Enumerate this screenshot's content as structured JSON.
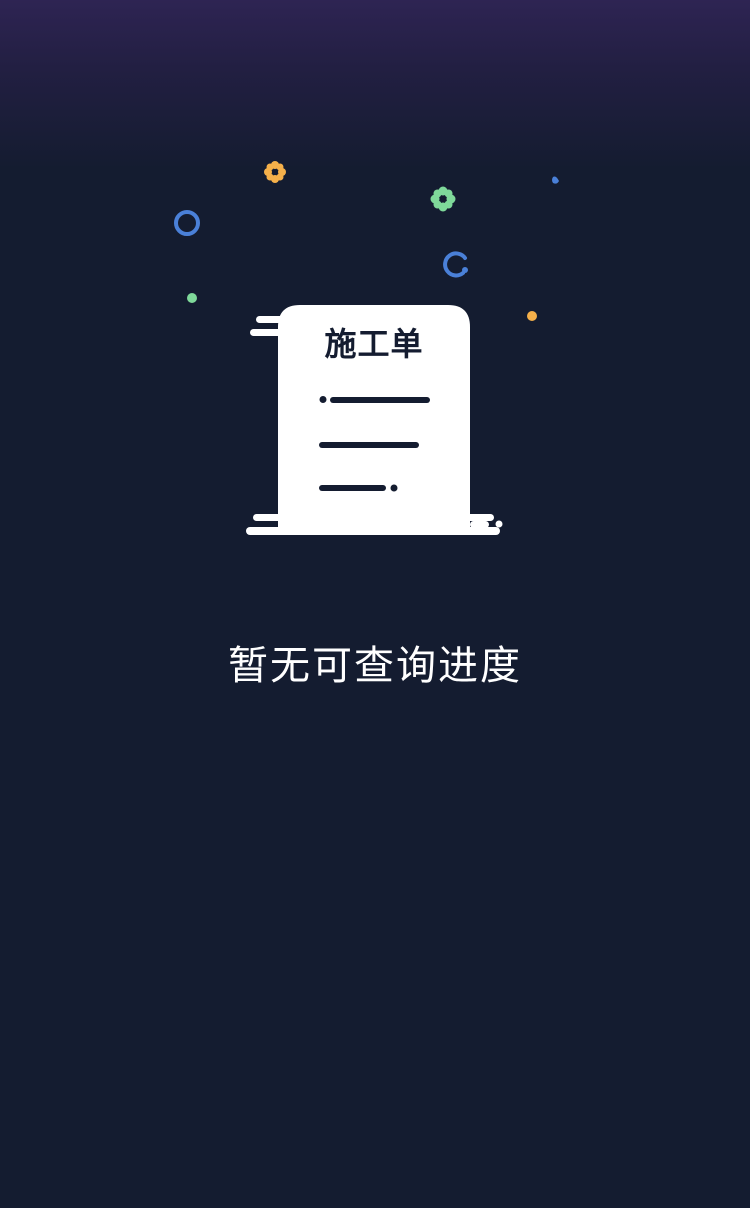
{
  "illustration": {
    "document_title": "施工单",
    "icon": "work-order-document-icon"
  },
  "empty_state": {
    "message": "暂无可查询进度"
  },
  "colors": {
    "background": "#141c30",
    "top_glow": "#2e2453",
    "document": "#ffffff",
    "accent_blue": "#4a80d8",
    "accent_green": "#7fd99a",
    "accent_orange": "#f5b04a"
  }
}
